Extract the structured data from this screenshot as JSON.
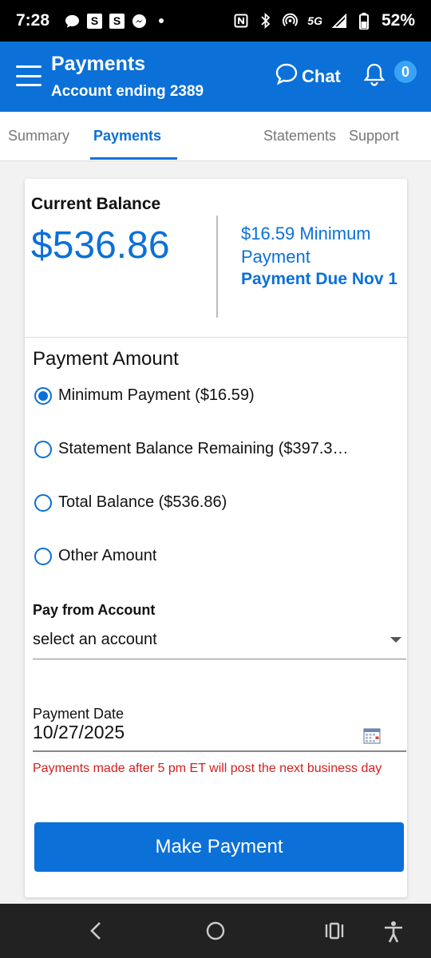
{
  "status_bar": {
    "time": "7:28",
    "network": "5G",
    "battery": "52%",
    "app_icon_letters": [
      "S",
      "S"
    ]
  },
  "header": {
    "title": "Payments",
    "subtitle": "Account ending 2389",
    "chat_label": "Chat",
    "notification_count": "0"
  },
  "tabs": [
    {
      "label": "Summary",
      "active": false
    },
    {
      "label": "Payments",
      "active": true
    },
    {
      "label": "Statements",
      "active": false
    },
    {
      "label": "Support",
      "active": false
    }
  ],
  "balance": {
    "label": "Current Balance",
    "amount": "$536.86",
    "minimum_payment": "$16.59 Minimum Payment",
    "due": "Payment Due Nov 1"
  },
  "payment_amount": {
    "label": "Payment Amount",
    "options": [
      {
        "label": "Minimum Payment ($16.59)",
        "selected": true
      },
      {
        "label": "Statement Balance Remaining ($397.3…",
        "selected": false
      },
      {
        "label": "Total Balance ($536.86)",
        "selected": false
      },
      {
        "label": "Other Amount",
        "selected": false
      }
    ]
  },
  "pay_from": {
    "label": "Pay from Account",
    "value": "select an account"
  },
  "payment_date": {
    "label": "Payment Date",
    "value": "10/27/2025"
  },
  "notice": "Payments made after 5 pm ET will post the next business day",
  "submit_label": "Make Payment",
  "colors": {
    "primary": "#0b70d8",
    "badge": "#3aa3f5",
    "error": "#d21f1f"
  }
}
